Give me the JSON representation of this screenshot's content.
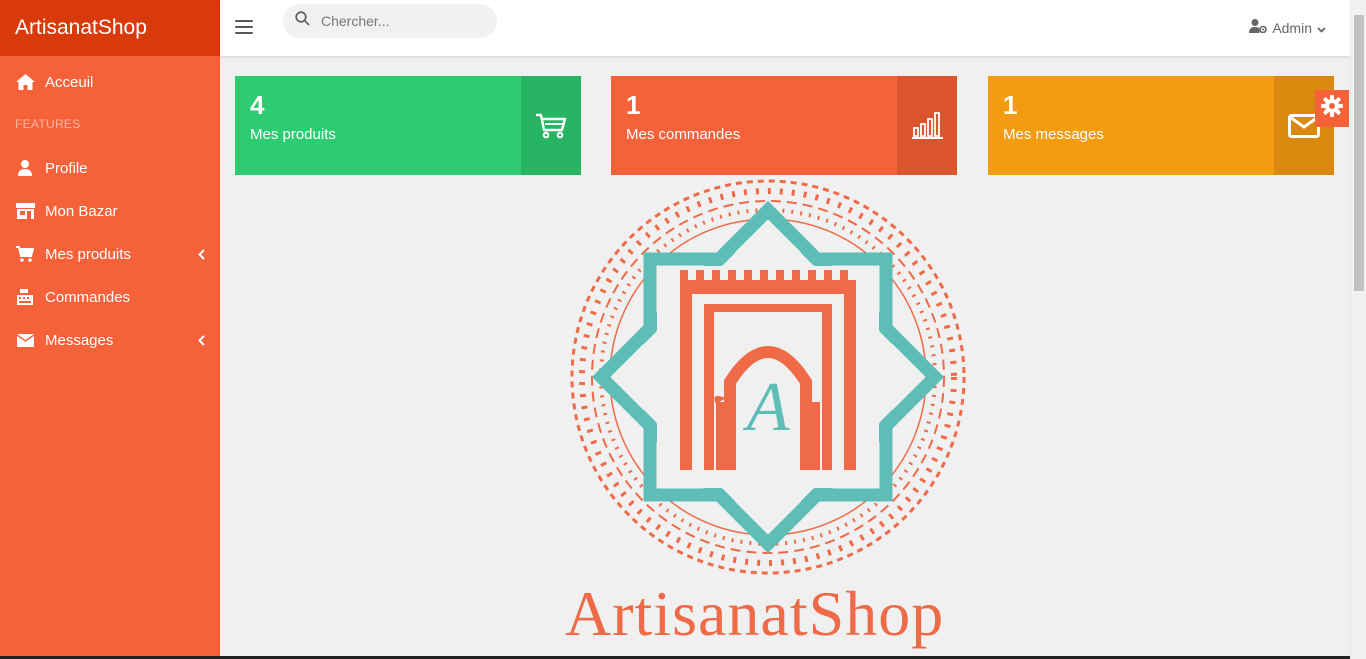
{
  "sidebar": {
    "brand": "ArtisanatShop",
    "section_label": "FEATURES",
    "items": [
      {
        "label": "Acceuil",
        "icon": "home-icon"
      },
      {
        "label": "Profile",
        "icon": "user-icon"
      },
      {
        "label": "Mon Bazar",
        "icon": "store-icon"
      },
      {
        "label": "Mes produits",
        "icon": "cart-icon"
      },
      {
        "label": "Commandes",
        "icon": "cash-register-icon"
      },
      {
        "label": "Messages",
        "icon": "envelope-icon"
      }
    ]
  },
  "topbar": {
    "search_placeholder": "Chercher...",
    "user_label": "Admin"
  },
  "cards": [
    {
      "count": "4",
      "label": "Mes produits",
      "icon": "shopping-cart-icon",
      "color": "#2ecc71"
    },
    {
      "count": "1",
      "label": "Mes commandes",
      "icon": "bar-chart-icon",
      "color": "#f5623a"
    },
    {
      "count": "1",
      "label": "Mes messages",
      "icon": "envelope-icon",
      "color": "#f39c12"
    }
  ],
  "logo": {
    "text": "ArtisanatShop",
    "monogram": "A"
  },
  "colors": {
    "sidebar": "#f5623a",
    "brand_bar": "#d93a0c",
    "teal": "#5fbdb8"
  }
}
